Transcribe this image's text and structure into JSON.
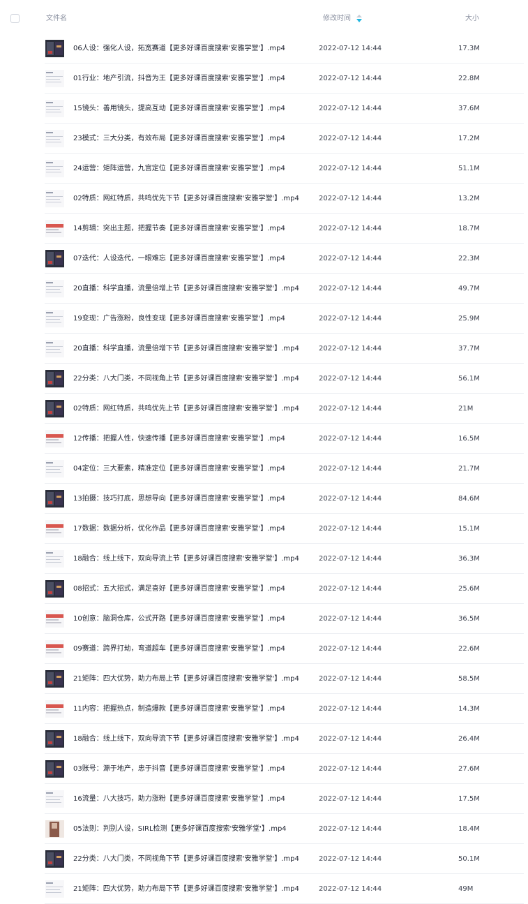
{
  "header": {
    "name_label": "文件名",
    "time_label": "修改时间",
    "size_label": "大小"
  },
  "files": [
    {
      "name": "06人设：强化人设，拓宽赛道【更多好课百度搜索'安雅学堂'】.mp4",
      "time": "2022-07-12 14:44",
      "size": "17.3M",
      "thumb": "dark"
    },
    {
      "name": "01行业：地产引流，抖音为王【更多好课百度搜索'安雅学堂'】.mp4",
      "time": "2022-07-12 14:44",
      "size": "22.8M",
      "thumb": "doc"
    },
    {
      "name": "15镜头：善用镜头，提高互动【更多好课百度搜索'安雅学堂'】.mp4",
      "time": "2022-07-12 14:44",
      "size": "37.6M",
      "thumb": "doc"
    },
    {
      "name": "23模式：三大分类，有效布局【更多好课百度搜索'安雅学堂'】.mp4",
      "time": "2022-07-12 14:44",
      "size": "17.2M",
      "thumb": "doc"
    },
    {
      "name": "24运营：矩阵运营，九宫定位【更多好课百度搜索'安雅学堂'】.mp4",
      "time": "2022-07-12 14:44",
      "size": "51.1M",
      "thumb": "doc"
    },
    {
      "name": "02特质：网红特质，共鸣优先下节【更多好课百度搜索'安雅学堂'】.mp4",
      "time": "2022-07-12 14:44",
      "size": "13.2M",
      "thumb": "doc"
    },
    {
      "name": "14剪辑：突出主题，把握节奏【更多好课百度搜索'安雅学堂'】.mp4",
      "time": "2022-07-12 14:44",
      "size": "18.7M",
      "thumb": "red"
    },
    {
      "name": "07迭代：人设迭代，一眼难忘【更多好课百度搜索'安雅学堂'】.mp4",
      "time": "2022-07-12 14:44",
      "size": "22.3M",
      "thumb": "dark"
    },
    {
      "name": "20直播：科学直播，流量倍增上节【更多好课百度搜索'安雅学堂'】.mp4",
      "time": "2022-07-12 14:44",
      "size": "49.7M",
      "thumb": "doc"
    },
    {
      "name": "19变现：广告涨粉，良性变现【更多好课百度搜索'安雅学堂'】.mp4",
      "time": "2022-07-12 14:44",
      "size": "25.9M",
      "thumb": "doc"
    },
    {
      "name": "20直播：科学直播，流量倍增下节【更多好课百度搜索'安雅学堂'】.mp4",
      "time": "2022-07-12 14:44",
      "size": "37.7M",
      "thumb": "doc"
    },
    {
      "name": "22分类：八大门类，不同视角上节【更多好课百度搜索'安雅学堂'】.mp4",
      "time": "2022-07-12 14:44",
      "size": "56.1M",
      "thumb": "dark"
    },
    {
      "name": "02特质：网红特质，共鸣优先上节【更多好课百度搜索'安雅学堂'】.mp4",
      "time": "2022-07-12 14:44",
      "size": "21M",
      "thumb": "dark"
    },
    {
      "name": "12传播：把握人性，快速传播【更多好课百度搜索'安雅学堂'】.mp4",
      "time": "2022-07-12 14:44",
      "size": "16.5M",
      "thumb": "red"
    },
    {
      "name": "04定位：三大要素，精准定位【更多好课百度搜索'安雅学堂'】.mp4",
      "time": "2022-07-12 14:44",
      "size": "21.7M",
      "thumb": "doc"
    },
    {
      "name": "13拍摄：技巧打底，思想导向【更多好课百度搜索'安雅学堂'】.mp4",
      "time": "2022-07-12 14:44",
      "size": "84.6M",
      "thumb": "dark"
    },
    {
      "name": "17数据：数据分析，优化作品【更多好课百度搜索'安雅学堂'】.mp4",
      "time": "2022-07-12 14:44",
      "size": "15.1M",
      "thumb": "red"
    },
    {
      "name": "18融合：线上线下，双向导流上节【更多好课百度搜索'安雅学堂'】.mp4",
      "time": "2022-07-12 14:44",
      "size": "36.3M",
      "thumb": "doc"
    },
    {
      "name": "08招式：五大招式，满足喜好【更多好课百度搜索'安雅学堂'】.mp4",
      "time": "2022-07-12 14:44",
      "size": "25.6M",
      "thumb": "dark"
    },
    {
      "name": "10创意：脑洞仓库，公式开路【更多好课百度搜索'安雅学堂'】.mp4",
      "time": "2022-07-12 14:44",
      "size": "36.5M",
      "thumb": "red"
    },
    {
      "name": "09赛道：跨界打劫，弯道超车【更多好课百度搜索'安雅学堂'】.mp4",
      "time": "2022-07-12 14:44",
      "size": "22.6M",
      "thumb": "red"
    },
    {
      "name": "21矩阵：四大优势，助力布局上节【更多好课百度搜索'安雅学堂'】.mp4",
      "time": "2022-07-12 14:44",
      "size": "58.5M",
      "thumb": "dark"
    },
    {
      "name": "11内容：把握热点，制造爆款【更多好课百度搜索'安雅学堂'】.mp4",
      "time": "2022-07-12 14:44",
      "size": "14.3M",
      "thumb": "red"
    },
    {
      "name": "18融合：线上线下，双向导流下节【更多好课百度搜索'安雅学堂'】.mp4",
      "time": "2022-07-12 14:44",
      "size": "26.4M",
      "thumb": "dark"
    },
    {
      "name": "03账号：源于地产，忠于抖音【更多好课百度搜索'安雅学堂'】.mp4",
      "time": "2022-07-12 14:44",
      "size": "27.6M",
      "thumb": "dark"
    },
    {
      "name": "16流量：八大技巧，助力涨粉【更多好课百度搜索'安雅学堂'】.mp4",
      "time": "2022-07-12 14:44",
      "size": "17.5M",
      "thumb": "doc"
    },
    {
      "name": "05法则：判别人设，SIRL检测【更多好课百度搜索'安雅学堂'】.mp4",
      "time": "2022-07-12 14:44",
      "size": "18.4M",
      "thumb": "photo"
    },
    {
      "name": "22分类：八大门类，不同视角下节【更多好课百度搜索'安雅学堂'】.mp4",
      "time": "2022-07-12 14:44",
      "size": "50.1M",
      "thumb": "dark"
    },
    {
      "name": "21矩阵：四大优势，助力布局下节【更多好课百度搜索'安雅学堂'】.mp4",
      "time": "2022-07-12 14:44",
      "size": "49M",
      "thumb": "doc"
    }
  ]
}
